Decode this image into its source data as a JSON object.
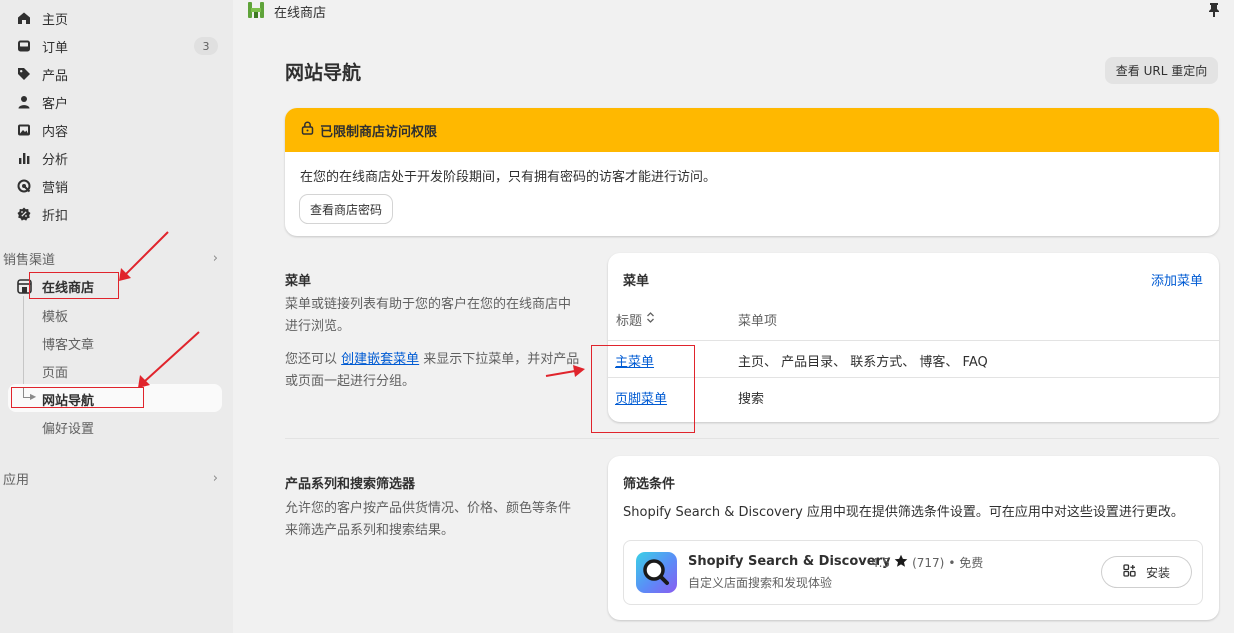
{
  "sidebar": {
    "items": [
      {
        "label": "主页",
        "icon": "home-icon"
      },
      {
        "label": "订单",
        "icon": "inbox-icon",
        "badge": "3"
      },
      {
        "label": "产品",
        "icon": "tag-icon"
      },
      {
        "label": "客户",
        "icon": "person-icon"
      },
      {
        "label": "内容",
        "icon": "image-icon"
      },
      {
        "label": "分析",
        "icon": "bar-chart-icon"
      },
      {
        "label": "营销",
        "icon": "target-icon"
      },
      {
        "label": "折扣",
        "icon": "discount-icon"
      }
    ],
    "sales_channels_label": "销售渠道",
    "online_store_label": "在线商店",
    "sub_items": [
      "模板",
      "博客文章",
      "页面",
      "网站导航",
      "偏好设置"
    ],
    "apps_label": "应用"
  },
  "topbar": {
    "title": "在线商店"
  },
  "page": {
    "title": "网站导航",
    "url_redirect_button": "查看 URL 重定向"
  },
  "banner": {
    "title": "已限制商店访问权限",
    "text": "在您的在线商店处于开发阶段期间，只有拥有密码的访客才能进行访问。",
    "button": "查看商店密码",
    "color": "#ffb800"
  },
  "menus_section": {
    "title": "菜单",
    "desc1": "菜单或链接列表有助于您的客户在您的在线商店中进行浏览。",
    "desc2_pre": "您还可以 ",
    "desc2_link": "创建嵌套菜单",
    "desc2_post": " 来显示下拉菜单，并对产品或页面一起进行分组。",
    "card_title": "菜单",
    "add_menu": "添加菜单",
    "col_title": "标题",
    "col_items": "菜单项",
    "rows": [
      {
        "title": "主菜单",
        "items": "主页、 产品目录、 联系方式、 博客、 FAQ"
      },
      {
        "title": "页脚菜单",
        "items": "搜索"
      }
    ]
  },
  "filters_section": {
    "title": "产品系列和搜索筛选器",
    "desc": "允许您的客户按产品供货情况、价格、颜色等条件来筛选产品系列和搜索结果。",
    "card_title": "筛选条件",
    "card_desc": "Shopify Search & Discovery 应用中现在提供筛选条件设置。可在应用中对这些设置进行更改。",
    "app": {
      "name": "Shopify Search & Discovery",
      "rating": "4.5",
      "reviews": "(717)",
      "price": "• 免费",
      "subtitle": "自定义店面搜索和发现体验",
      "install": "安装"
    }
  },
  "colors": {
    "link": "#005bd3",
    "annotation": "#e0242c"
  }
}
